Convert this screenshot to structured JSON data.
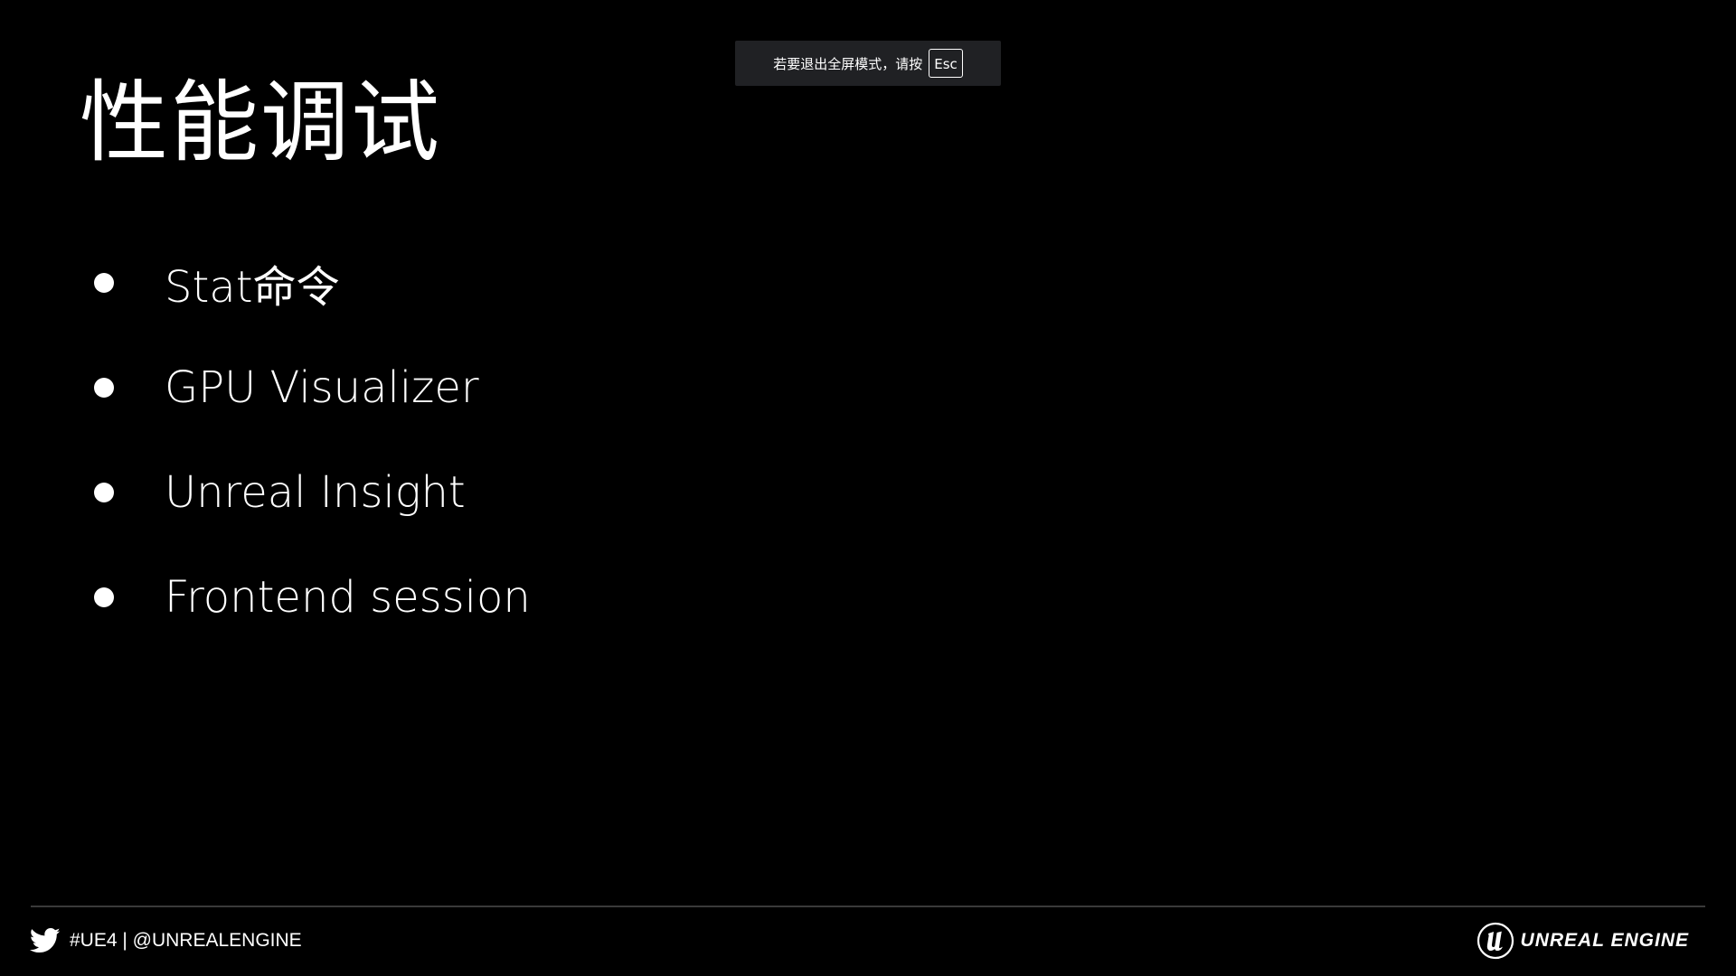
{
  "fullscreen_notice": {
    "message": "若要退出全屏模式，请按",
    "key": "Esc"
  },
  "slide": {
    "title": "性能调试",
    "bullets": [
      {
        "text": "Stat命令"
      },
      {
        "text": "GPU Visualizer"
      },
      {
        "text": "Unreal Insight"
      },
      {
        "text": "Frontend session"
      }
    ]
  },
  "footer": {
    "social_handle": "#UE4 | @UNREALENGINE",
    "brand_name": "UNREAL ENGINE",
    "icons": {
      "social": "twitter-bird-icon",
      "brand": "unreal-engine-logo"
    }
  },
  "colors": {
    "background": "#000000",
    "text": "#ffffff",
    "notice_background": "#202124",
    "divider": "#3a3a3a"
  }
}
